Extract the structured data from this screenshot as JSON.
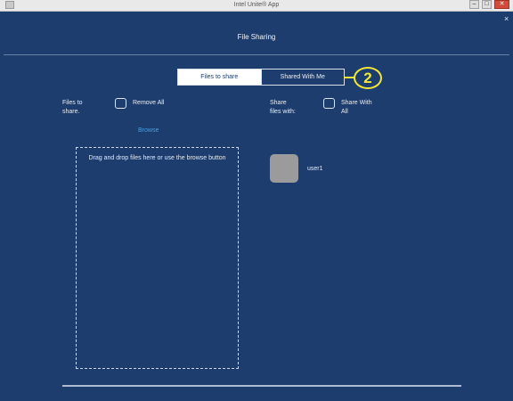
{
  "window": {
    "title": "Intel Unite® App",
    "controls": {
      "minimize": "–",
      "maximize": "□",
      "close": "✕"
    }
  },
  "header": {
    "title": "File Sharing",
    "close_glyph": "×"
  },
  "tabs": [
    {
      "label": "Files to share",
      "active": true
    },
    {
      "label": "Shared With Me",
      "active": false
    }
  ],
  "callout": {
    "number": "2",
    "color": "#f3e63a"
  },
  "files": {
    "label": "Files to share.",
    "remove_all_label": "Remove All",
    "browse_label": "Browse",
    "dropzone_text": "Drag and drop files here or use the browse button"
  },
  "share": {
    "label": "Share files with:",
    "share_all_label": "Share With All",
    "users": [
      {
        "name": "user1"
      }
    ]
  },
  "colors": {
    "background": "#1c3d6e",
    "accent_link": "#4f9fe0",
    "avatar": "#9b9b9b"
  },
  "icons": {
    "app": "app-icon",
    "close": "close-icon"
  }
}
